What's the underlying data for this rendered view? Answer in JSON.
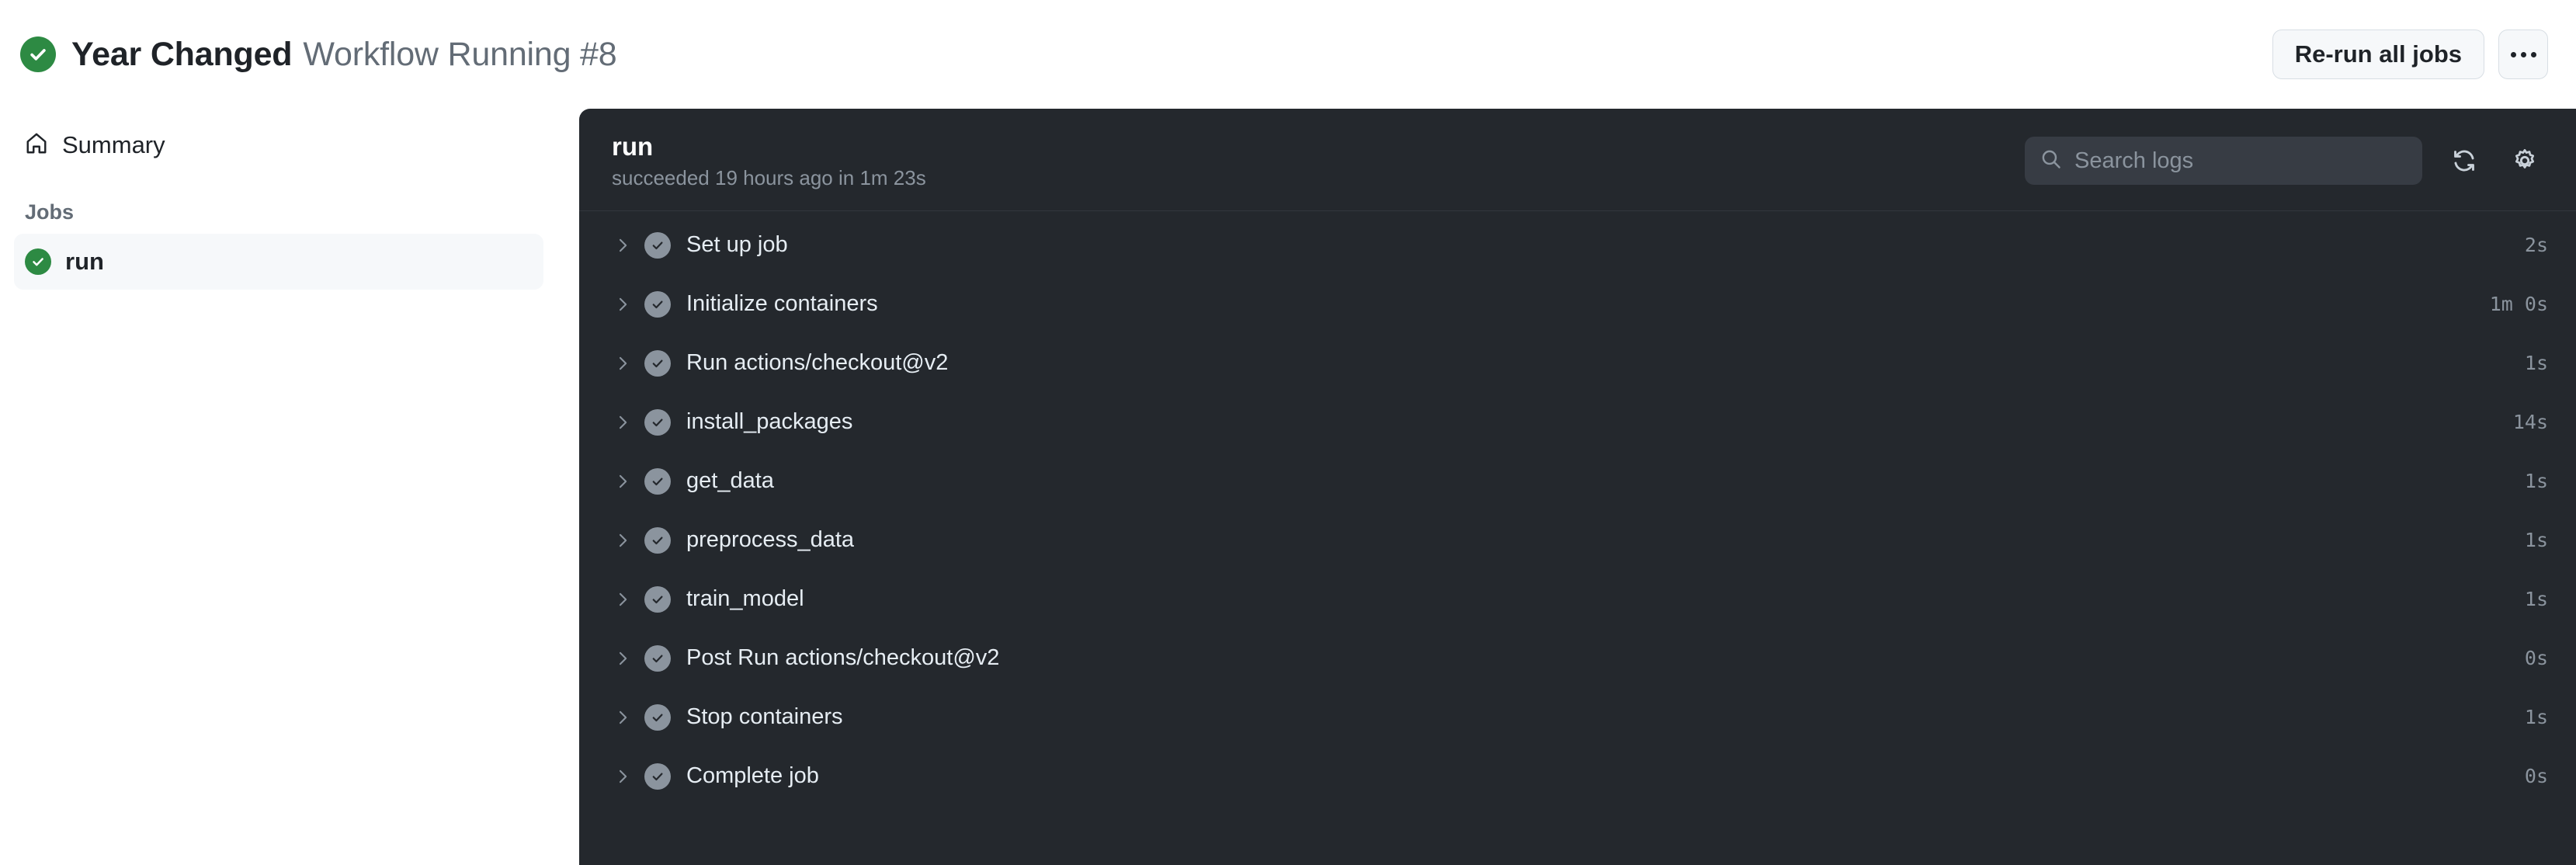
{
  "header": {
    "status_icon": "check-circle-icon",
    "status_color": "#2d8a43",
    "title": "Year Changed",
    "subtitle": "Workflow Running #8",
    "rerun_button": "Re-run all jobs",
    "kebab_icon": "kebab-horizontal-icon"
  },
  "sidebar": {
    "summary_label": "Summary",
    "summary_icon": "home-icon",
    "jobs_section_label": "Jobs",
    "jobs": [
      {
        "label": "run",
        "status_icon": "check-circle-fill-icon",
        "selected": true
      }
    ]
  },
  "log": {
    "title": "run",
    "status": "succeeded 19 hours ago in 1m 23s",
    "search": {
      "placeholder": "Search logs",
      "value": "",
      "icon": "search-icon"
    },
    "refresh_icon": "sync-icon",
    "settings_icon": "gear-icon",
    "steps": [
      {
        "name": "Set up job",
        "duration": "2s",
        "status_icon": "check-circle-fill-icon",
        "chevron": "chevron-right-icon"
      },
      {
        "name": "Initialize containers",
        "duration": "1m 0s",
        "status_icon": "check-circle-fill-icon",
        "chevron": "chevron-right-icon"
      },
      {
        "name": "Run actions/checkout@v2",
        "duration": "1s",
        "status_icon": "check-circle-fill-icon",
        "chevron": "chevron-right-icon"
      },
      {
        "name": "install_packages",
        "duration": "14s",
        "status_icon": "check-circle-fill-icon",
        "chevron": "chevron-right-icon"
      },
      {
        "name": "get_data",
        "duration": "1s",
        "status_icon": "check-circle-fill-icon",
        "chevron": "chevron-right-icon"
      },
      {
        "name": "preprocess_data",
        "duration": "1s",
        "status_icon": "check-circle-fill-icon",
        "chevron": "chevron-right-icon"
      },
      {
        "name": "train_model",
        "duration": "1s",
        "status_icon": "check-circle-fill-icon",
        "chevron": "chevron-right-icon"
      },
      {
        "name": "Post Run actions/checkout@v2",
        "duration": "0s",
        "status_icon": "check-circle-fill-icon",
        "chevron": "chevron-right-icon"
      },
      {
        "name": "Stop containers",
        "duration": "1s",
        "status_icon": "check-circle-fill-icon",
        "chevron": "chevron-right-icon"
      },
      {
        "name": "Complete job",
        "duration": "0s",
        "status_icon": "check-circle-fill-icon",
        "chevron": "chevron-right-icon"
      }
    ]
  },
  "colors": {
    "success": "#2d8a43",
    "panel_bg": "#24282d",
    "page_bg": "#ffffff",
    "muted_text": "#8b949e"
  }
}
